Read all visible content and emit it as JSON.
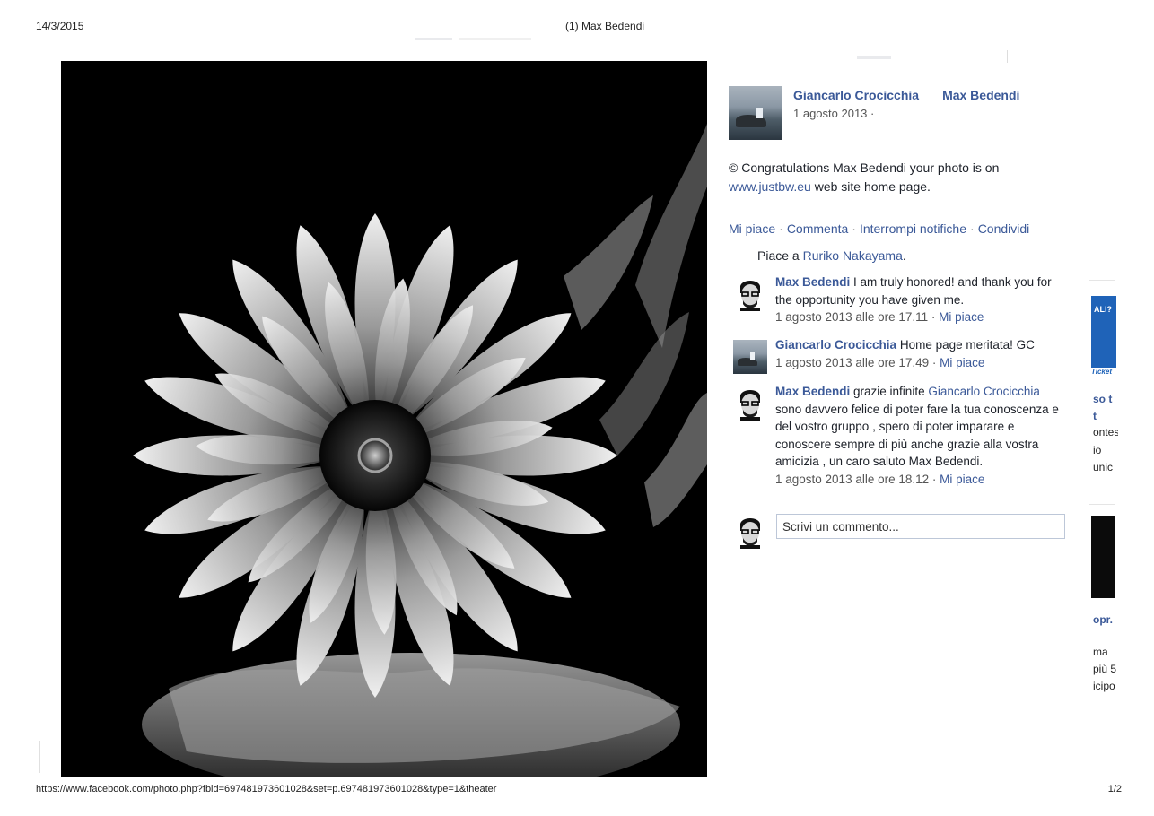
{
  "print": {
    "date": "14/3/2015",
    "title": "(1) Max Bedendi",
    "url": "https://www.facebook.com/photo.php?fbid=697481973601028&set=p.697481973601028&type=1&theater",
    "page": "1/2"
  },
  "photo": {
    "alt": "Black and white photograph of a chrysanthemum flower with its reflection"
  },
  "post": {
    "author": "Giancarlo Crocicchia",
    "target": "Max Bedendi",
    "date": "1 agosto 2013 ·",
    "text_before_link": "© Congratulations Max Bedendi your photo is on",
    "link": "www.justbw.eu",
    "text_after_link": " web site home page.",
    "actions": [
      "Mi piace",
      "Commenta",
      "Interrompi notifiche",
      "Condividi"
    ],
    "likes_prefix": "Piace a ",
    "likes_name": "Ruriko Nakayama",
    "likes_suffix": "."
  },
  "comments": [
    {
      "author": "Max Bedendi",
      "text": " I am truly honored! and thank you for the opportunity you have given me.",
      "time": "1 agosto 2013 alle ore 17.11",
      "like": "Mi piace"
    },
    {
      "author": "Giancarlo Crocicchia",
      "text": " Home page meritata! GC",
      "time": "1 agosto 2013 alle ore 17.49",
      "like": "Mi piace"
    },
    {
      "author": "Max Bedendi",
      "text_before_mention": " grazie infinite ",
      "mention": "Giancarlo Crocicchia",
      "text": " sono davvero felice di poter fare la tua conoscenza e del vostro gruppo , spero di poter imparare e conoscere sempre di più anche grazie alla vostra amicizia , un caro saluto Max Bedendi.",
      "time": "1 agosto 2013 alle ore 18.12",
      "like": "Mi piace"
    }
  ],
  "composer": {
    "placeholder": "Scrivi un commento..."
  },
  "sidebar_strip": {
    "ad_text": "ALI?",
    "ad_logo": "Ticket",
    "lines": [
      "so t",
      "t",
      "ontes",
      "io",
      "unic",
      "opr.",
      "ma",
      "più 5",
      "icipo"
    ]
  }
}
